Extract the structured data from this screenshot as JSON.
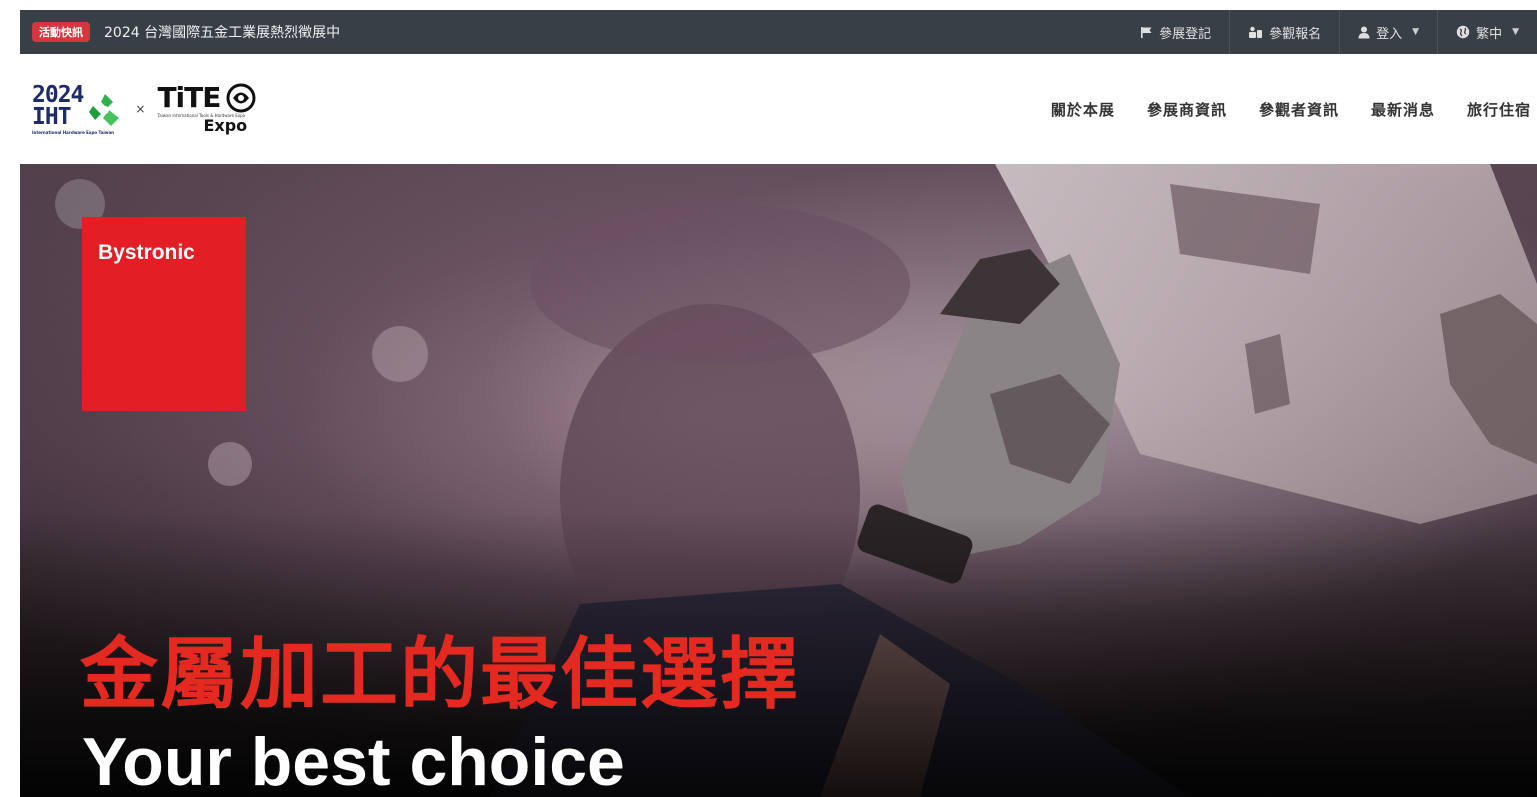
{
  "topbar": {
    "badge": "活動快訊",
    "news": "2024 台灣國際五金工業展熱烈徵展中",
    "items": [
      {
        "label": "參展登記",
        "icon": "flag-icon"
      },
      {
        "label": "參觀報名",
        "icon": "visitor-icon"
      },
      {
        "label": "登入",
        "icon": "user-icon",
        "dropdown": true
      },
      {
        "label": "繁中",
        "icon": "globe-icon",
        "dropdown": true
      }
    ]
  },
  "logo": {
    "iht_year": "2024",
    "iht_name": "IHT",
    "iht_sub": "International Hardware Expo Taiwan",
    "times": "×",
    "tite": "TiTE",
    "tite_sub": "Taiwan International Tools & Hardware Expo",
    "expo": "Expo"
  },
  "nav": {
    "items": [
      "關於本展",
      "參展商資訊",
      "參觀者資訊",
      "最新消息",
      "旅行住宿"
    ]
  },
  "hero": {
    "brand": "Bystronic",
    "title_zh": "金屬加工的最佳選擇",
    "title_en": "Your best choice",
    "colors": {
      "brand_red": "#e31e24",
      "title_red": "#e42a20",
      "topbar": "#393f46",
      "badge": "#d6373f"
    }
  }
}
